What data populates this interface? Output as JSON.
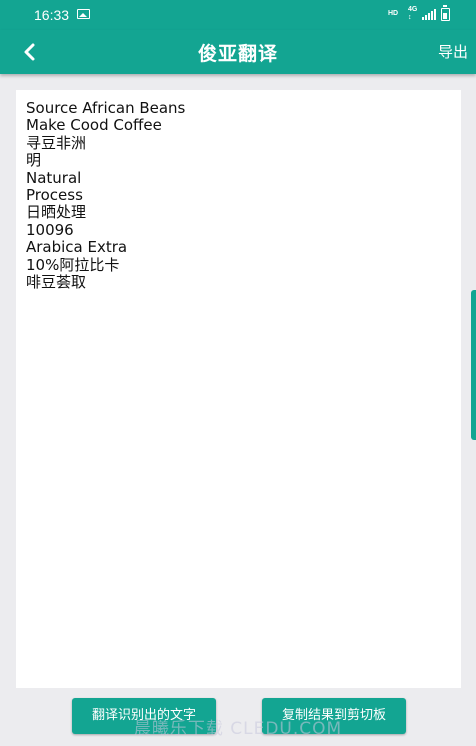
{
  "status_bar": {
    "time": "16:33",
    "network_hd": "HD",
    "network_4g_top": "4G",
    "network_4g_bottom": "↕"
  },
  "app_bar": {
    "title": "俊亚翻译",
    "export_label": "导出",
    "back_icon": "chevron-left-icon"
  },
  "ocr_result": {
    "lines": [
      "Source African Beans",
      "Make Cood Coffee",
      "寻豆非洲",
      "明",
      "Natural",
      "Process",
      "日晒处理",
      "10096",
      "Arabica Extra",
      "10%阿拉比卡",
      "啡豆荟取"
    ]
  },
  "actions": {
    "translate_label": "翻译识别出的文字",
    "copy_label": "复制结果到剪切板"
  },
  "watermark": "晨曦乐下载 CLEDU.COM",
  "colors": {
    "accent": "#13a592",
    "background": "#ececef",
    "panel": "#ffffff"
  }
}
